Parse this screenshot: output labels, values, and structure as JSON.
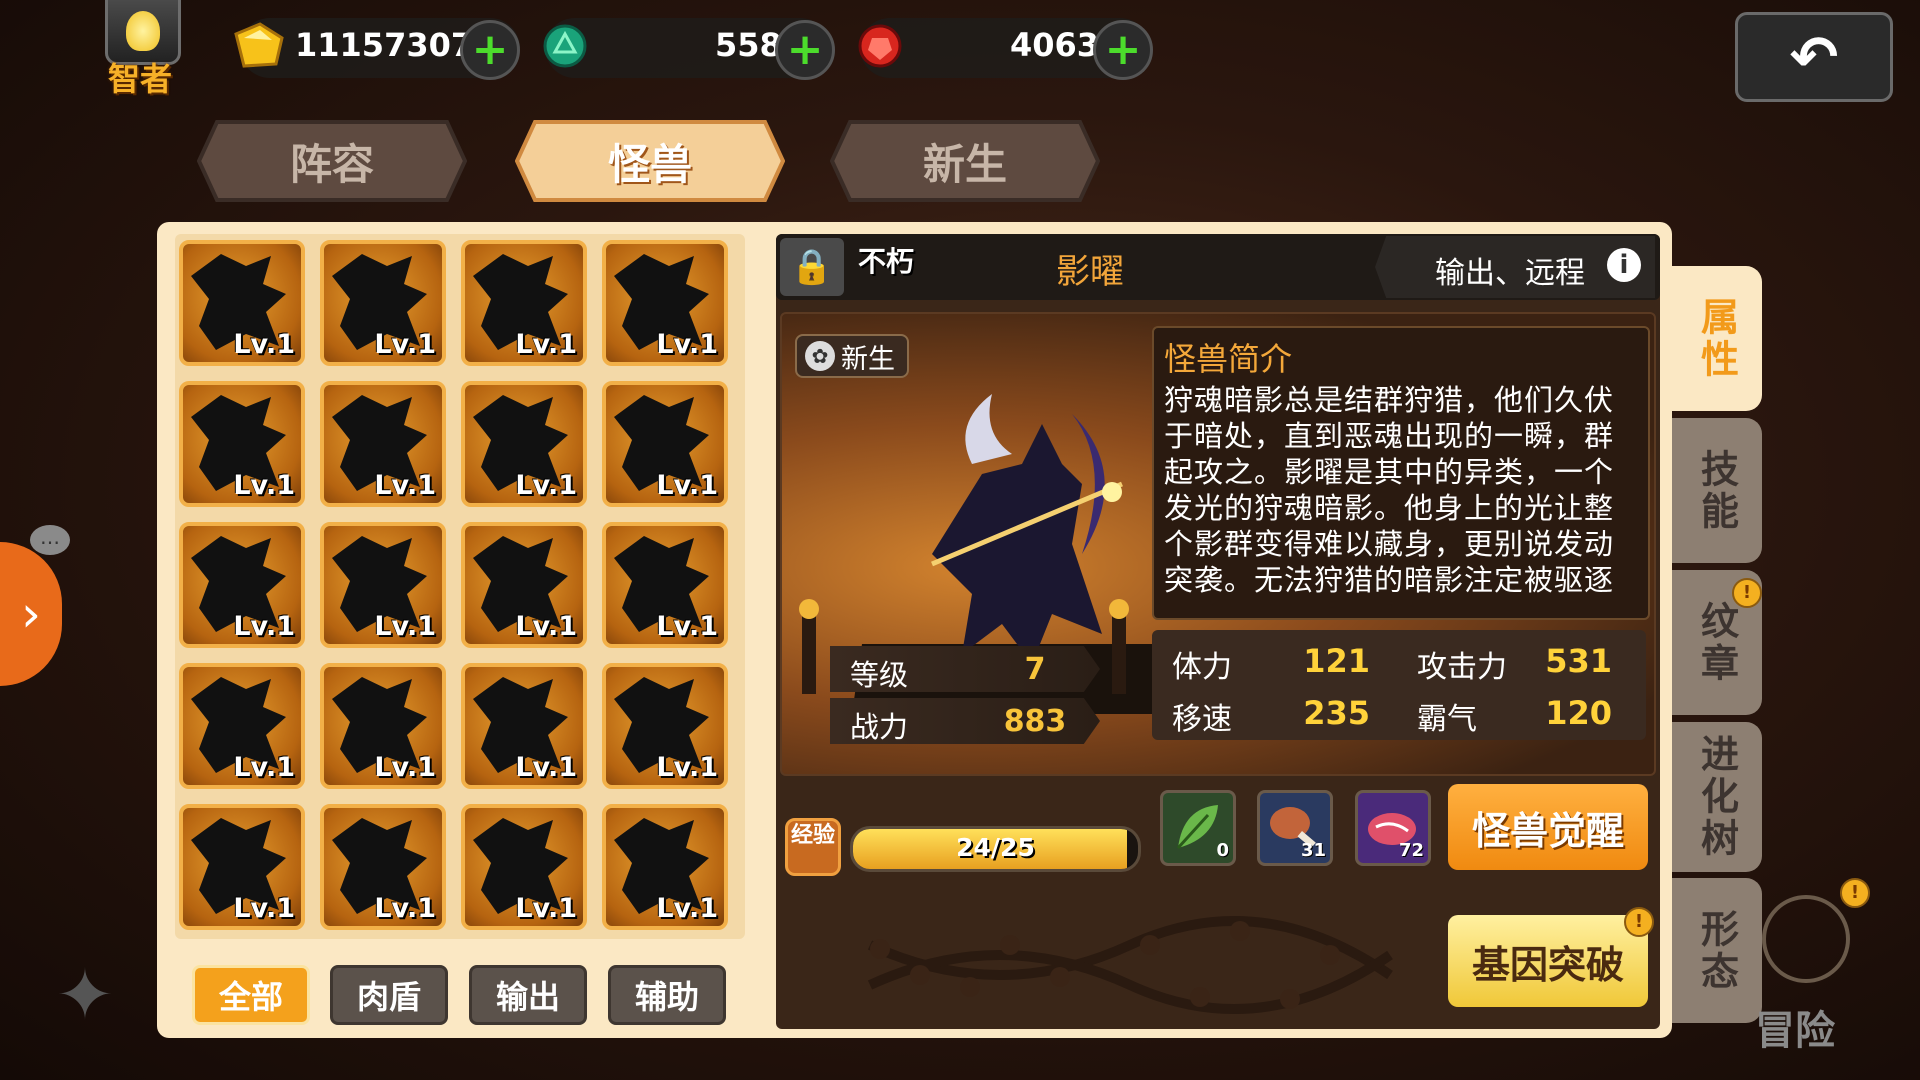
{
  "player": {
    "title": "智者",
    "icon": "lightbulb-icon"
  },
  "resources": [
    {
      "name": "gold",
      "icon": "gold-coin-icon",
      "value": "111573079"
    },
    {
      "name": "emerald",
      "icon": "green-gem-icon",
      "value": "558"
    },
    {
      "name": "ruby",
      "icon": "red-gem-icon",
      "value": "4063"
    }
  ],
  "back_icon": "back-arrow-icon",
  "tabs": [
    {
      "label": "阵容",
      "active": false
    },
    {
      "label": "怪兽",
      "active": true
    },
    {
      "label": "新生",
      "active": false
    }
  ],
  "monster_grid": {
    "level_label": "Lv.1",
    "count": 20
  },
  "filters": [
    "全部",
    "肉盾",
    "输出",
    "辅助"
  ],
  "monster": {
    "badge": "不朽",
    "name": "影曜",
    "role": "输出、远程",
    "tag": "新生",
    "intro_title": "怪兽简介",
    "intro_text": "狩魂暗影总是结群狩猎，他们久伏于暗处，直到恶魂出现的一瞬，群起攻之。影曜是其中的异类，一个发光的狩魂暗影。他身上的光让整个影群变得难以藏身，更别说发动突袭。无法狩猎的暗影注定被驱逐",
    "level_label": "等级",
    "level": "7",
    "power_label": "战力",
    "power": "883",
    "stats": [
      {
        "label": "体力",
        "value": "121"
      },
      {
        "label": "攻击力",
        "value": "531"
      },
      {
        "label": "移速",
        "value": "235"
      },
      {
        "label": "霸气",
        "value": "120"
      }
    ]
  },
  "exp": {
    "label": "经验",
    "text": "24/25",
    "fraction": 0.96
  },
  "items": [
    {
      "icon": "green-leaf-icon",
      "count": "0"
    },
    {
      "icon": "meat-leg-icon",
      "count": "31"
    },
    {
      "icon": "steak-icon",
      "count": "72"
    }
  ],
  "buttons": {
    "awaken": "怪兽觉醒",
    "gene": "基因突破"
  },
  "side_tabs": [
    {
      "label": "属性",
      "active": true
    },
    {
      "label": "技能",
      "active": false
    },
    {
      "label": "纹章",
      "active": false
    },
    {
      "label": "进化树",
      "active": false
    },
    {
      "label": "形态",
      "active": false
    }
  ],
  "bottom_right_label": "冒险",
  "colors": {
    "accent": "#f4a11c",
    "panel": "#fbe8c4",
    "gold_text": "#ffd23a",
    "plus_green": "#4cdc2c"
  }
}
